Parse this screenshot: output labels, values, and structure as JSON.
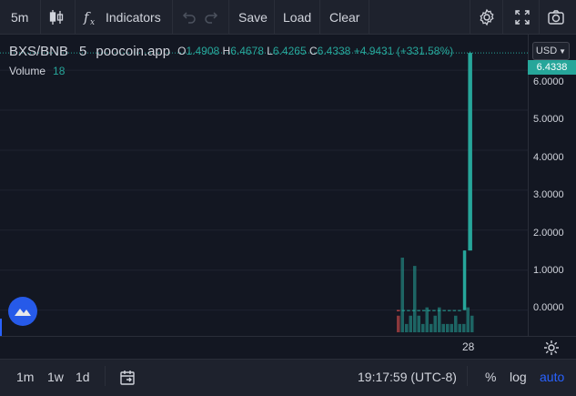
{
  "toolbar": {
    "interval": "5m",
    "indicators_label": "Indicators",
    "save_label": "Save",
    "load_label": "Load",
    "clear_label": "Clear"
  },
  "legend": {
    "symbol": "BXS/BNB",
    "interval": "5",
    "source": "poocoin.app",
    "open_key": "O",
    "open": "1.4908",
    "high_key": "H",
    "high": "6.4678",
    "low_key": "L",
    "low": "6.4265",
    "close_key": "C",
    "close": "6.4338",
    "change": "+4.9431 (+331.58%)",
    "volume_label": "Volume",
    "volume": "18"
  },
  "price_scale": {
    "currency": "USD",
    "last_price": "6.4338",
    "labels": [
      "6.0000",
      "5.0000",
      "4.0000",
      "3.0000",
      "2.0000",
      "1.0000",
      "0.0000"
    ]
  },
  "time_axis": {
    "label": "28"
  },
  "bottom": {
    "range_1m": "1m",
    "range_1w": "1w",
    "range_1d": "1d",
    "clock": "19:17:59 (UTC-8)",
    "percent_label": "%",
    "log_label": "log",
    "auto_label": "auto"
  },
  "colors": {
    "up": "#26a69a",
    "down": "#ef5350",
    "accent": "#2962ff",
    "background": "#131722"
  },
  "chart_data": {
    "type": "candlestick",
    "ylim": [
      -0.6,
      6.8
    ],
    "candles": [
      {
        "open": 0.0,
        "high": 0.0,
        "low": 0.0,
        "close": 0.0
      },
      {
        "open": 0.0,
        "high": 0.0,
        "low": 0.0,
        "close": 0.0
      },
      {
        "open": 0.0,
        "high": 0.0,
        "low": 0.0,
        "close": 0.0
      },
      {
        "open": 0.0,
        "high": 0.0,
        "low": 0.0,
        "close": 0.0
      },
      {
        "open": 0.0,
        "high": 0.0,
        "low": 0.0,
        "close": 0.0
      },
      {
        "open": 0.0,
        "high": 0.0,
        "low": 0.0,
        "close": 0.0
      },
      {
        "open": 0.0,
        "high": 0.0,
        "low": 0.0,
        "close": 0.0
      },
      {
        "open": 0.0,
        "high": 0.0,
        "low": 0.0,
        "close": 0.0
      },
      {
        "open": 0.0,
        "high": 0.0,
        "low": 0.0,
        "close": 0.0
      },
      {
        "open": 0.0,
        "high": 0.0,
        "low": 0.0,
        "close": 0.0
      },
      {
        "open": 0.0,
        "high": 0.0,
        "low": 0.0,
        "close": 0.0
      },
      {
        "open": 0.0,
        "high": 0.0,
        "low": 0.0,
        "close": 0.0
      },
      {
        "open": 0.0,
        "high": 0.0,
        "low": 0.0,
        "close": 0.0
      },
      {
        "open": 0.0,
        "high": 1.4908,
        "low": 0.0,
        "close": 1.4908
      },
      {
        "open": 1.4908,
        "high": 6.4678,
        "low": 1.4908,
        "close": 6.4338
      }
    ],
    "volume": [
      2,
      9,
      1,
      2,
      8,
      2,
      1,
      3,
      1,
      2,
      3,
      1,
      1,
      1,
      2,
      1,
      1,
      3,
      2
    ],
    "volume_colors": [
      "down",
      "up",
      "up",
      "up",
      "up",
      "up",
      "up",
      "up",
      "up",
      "up",
      "up",
      "up",
      "up",
      "up",
      "up",
      "up",
      "up",
      "up",
      "up"
    ]
  }
}
